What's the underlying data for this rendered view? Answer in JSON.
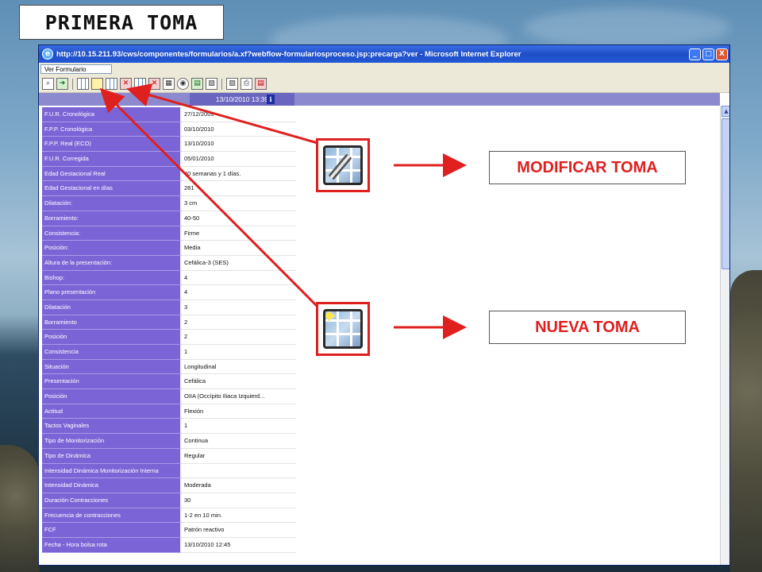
{
  "slide_title": "PRIMERA TOMA",
  "browser": {
    "title": "http://10.15.211.93/cws/componentes/formularios/a.xf?webflow-formulariosproceso.jsp:precarga?ver - Microsoft Internet Explorer",
    "form_selector": "Ver Formulario",
    "header_date": "13/10/2010 13:39",
    "info_glyph": "i",
    "window_buttons": [
      "_",
      "□",
      "X"
    ]
  },
  "form_rows": [
    {
      "label": "F.U.R. Cronológica",
      "value": "27/12/2009"
    },
    {
      "label": "F.P.P. Cronológica",
      "value": "03/10/2010"
    },
    {
      "label": "F.P.P. Real (ECO)",
      "value": "13/10/2010"
    },
    {
      "label": "F.U.R. Corregida",
      "value": "05/01/2010"
    },
    {
      "label": "Edad Gestacional Real",
      "value": "40 semanas y 1 días."
    },
    {
      "label": "Edad Gestacional en días",
      "value": "281"
    },
    {
      "label": "Dilatación:",
      "value": "3 cm"
    },
    {
      "label": "Borramiento:",
      "value": "40-50"
    },
    {
      "label": "Consistencia:",
      "value": "Firme"
    },
    {
      "label": "Posición:",
      "value": "Media"
    },
    {
      "label": "Altura de la presentación:",
      "value": "Cefálica-3 (SES)"
    },
    {
      "label": "Bishop:",
      "value": "4"
    },
    {
      "label": "Plano presentación",
      "value": "4"
    },
    {
      "label": "Dilatación",
      "value": "3"
    },
    {
      "label": "Borramiento",
      "value": "2"
    },
    {
      "label": "Posición",
      "value": "2"
    },
    {
      "label": "Consistencia",
      "value": "1"
    },
    {
      "label": "Situación",
      "value": "Longitudinal"
    },
    {
      "label": "Presentación",
      "value": "Cefálica"
    },
    {
      "label": "Posición",
      "value": "OIIA (Occípito Iliaca Izquierd..."
    },
    {
      "label": "Actitud",
      "value": "Flexión"
    },
    {
      "label": "Tactos Vaginales",
      "value": "1"
    },
    {
      "label": "Tipo de Monitorización",
      "value": "Continua"
    },
    {
      "label": "Tipo de Dinámica",
      "value": "Regular"
    },
    {
      "label": "Intensidad Dinámica Monitorización Interna",
      "value": ""
    },
    {
      "label": "Intensidad Dinámica",
      "value": "Moderada"
    },
    {
      "label": "Duración Contracciones",
      "value": "30"
    },
    {
      "label": "Frecuencia de contracciones",
      "value": "1-2 en 10 min."
    },
    {
      "label": "FCF",
      "value": "Patrón reactivo"
    },
    {
      "label": "Fecha - Hora bolsa rota",
      "value": "13/10/2010 12:45"
    }
  ],
  "callouts": {
    "modify_label": "MODIFICAR TOMA",
    "new_label": "NUEVA TOMA",
    "star_glyph": "✦"
  },
  "colors": {
    "label_bg": "#7b65d6",
    "accent_red": "#e01f1f"
  }
}
